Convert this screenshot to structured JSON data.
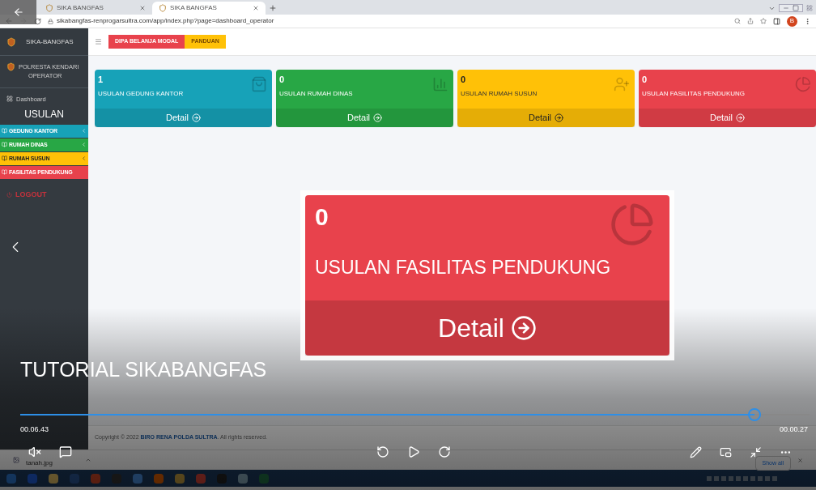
{
  "browser": {
    "tabs": [
      {
        "title": "SIKA BANGFAS",
        "selected": false
      },
      {
        "title": "SIKA BANGFAS",
        "selected": true
      }
    ],
    "url": "sikabangfas-renprogarsultra.com/app/index.php?page=dashboard_operator",
    "profile": "B"
  },
  "app": {
    "brand": "SIKA-BANGFAS",
    "top_buttons": [
      {
        "label": "DIPA BELANJA MODAL",
        "color": "#e8424c"
      },
      {
        "label": "PANDUAN",
        "color": "#ffc107"
      }
    ],
    "user": {
      "name": "POLRESTA KENDARI",
      "role": "OPERATOR"
    },
    "dashboard": "Dashboard",
    "section": "USULAN",
    "menu": [
      {
        "label": "GEDUNG KANTOR",
        "color": "#17a2b8",
        "expandable": true
      },
      {
        "label": "RUMAH DINAS",
        "color": "#28a745",
        "expandable": true
      },
      {
        "label": "RUMAH SUSUN",
        "color": "#ffc107",
        "expandable": true
      },
      {
        "label": "FASILITAS PENDUKUNG",
        "color": "#e8424c",
        "expandable": false
      }
    ],
    "logout": "LOGOUT",
    "cards": [
      {
        "count": "1",
        "label": "USULAN GEDUNG KANTOR",
        "detail": "Detail",
        "color": "#17a2b8"
      },
      {
        "count": "0",
        "label": "USULAN RUMAH DINAS",
        "detail": "Detail",
        "color": "#28a745"
      },
      {
        "count": "0",
        "label": "USULAN RUMAH SUSUN",
        "detail": "Detail",
        "color": "#ffc107"
      },
      {
        "count": "0",
        "label": "USULAN FASILITAS PENDUKUNG",
        "detail": "Detail",
        "color": "#e8424c"
      }
    ],
    "zoomed_card": {
      "count": "0",
      "label": "USULAN FASILITAS PENDUKUNG",
      "detail": "Detail"
    },
    "copyright": "Copyright © 2022 **BIRO RENA POLDA SULTRA**. All rights reserved."
  },
  "downloads": {
    "file": "tanah.jpg",
    "show_all": "Show all"
  },
  "video": {
    "title": "TUTORIAL SIKABANGFAS",
    "elapsed": "00.06.43",
    "remaining": "00.00.27",
    "level": 0.93
  }
}
